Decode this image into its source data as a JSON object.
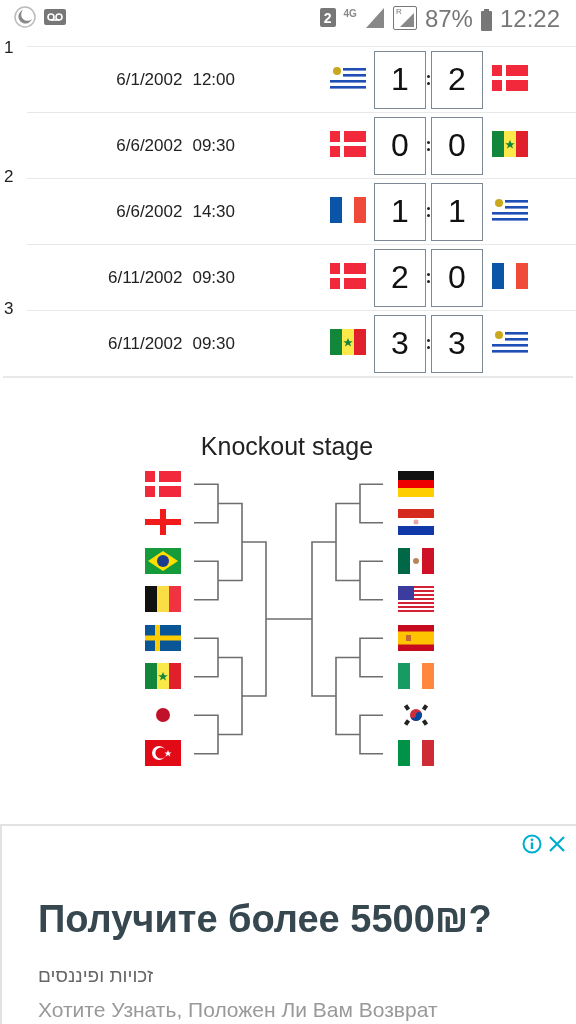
{
  "status_bar": {
    "sim_badge": "2",
    "network": "4G",
    "roaming": "R",
    "battery": "87%",
    "time": "12:22"
  },
  "rounds": [
    {
      "label": "1",
      "matches": [
        {
          "date": "6/1/2002",
          "time": "12:00",
          "home_flag": {
            "kind": "uruguay"
          },
          "home_score": "1",
          "away_score": "2",
          "away_flag": {
            "kind": "denmark"
          }
        }
      ]
    },
    {
      "label": "2",
      "matches": [
        {
          "date": "6/6/2002",
          "time": "09:30",
          "home_flag": {
            "kind": "denmark"
          },
          "home_score": "0",
          "away_score": "0",
          "away_flag": {
            "kind": "senegal"
          }
        },
        {
          "date": "6/6/2002",
          "time": "14:30",
          "home_flag": {
            "kind": "france"
          },
          "home_score": "1",
          "away_score": "1",
          "away_flag": {
            "kind": "uruguay"
          }
        }
      ]
    },
    {
      "label": "3",
      "matches": [
        {
          "date": "6/11/2002",
          "time": "09:30",
          "home_flag": {
            "kind": "denmark"
          },
          "home_score": "2",
          "away_score": "0",
          "away_flag": {
            "kind": "france"
          }
        },
        {
          "date": "6/11/2002",
          "time": "09:30",
          "home_flag": {
            "kind": "senegal"
          },
          "home_score": "3",
          "away_score": "3",
          "away_flag": {
            "kind": "uruguay"
          }
        }
      ]
    }
  ],
  "knockout": {
    "title": "Knockout stage",
    "left": [
      {
        "kind": "denmark"
      },
      {
        "kind": "england"
      },
      {
        "kind": "brazil"
      },
      {
        "kind": "belgium"
      },
      {
        "kind": "sweden"
      },
      {
        "kind": "senegal"
      },
      {
        "kind": "japan"
      },
      {
        "kind": "turkey"
      }
    ],
    "right": [
      {
        "kind": "germany"
      },
      {
        "kind": "paraguay"
      },
      {
        "kind": "mexico"
      },
      {
        "kind": "usa"
      },
      {
        "kind": "spain"
      },
      {
        "kind": "ireland"
      },
      {
        "kind": "korea"
      },
      {
        "kind": "italy"
      }
    ]
  },
  "ad": {
    "headline": "Получите более 5500₪?",
    "source": "זכויות ופיננסים",
    "text": "Хотите Узнать, Положен Ли Вам Возврат"
  }
}
